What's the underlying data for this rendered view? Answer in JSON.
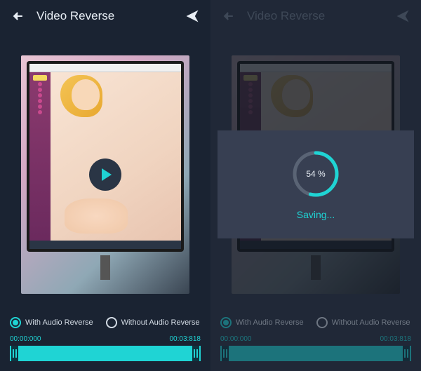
{
  "left": {
    "header": {
      "title": "Video Reverse"
    },
    "radios": {
      "with_audio": "With Audio Reverse",
      "without_audio": "Without Audio  Reverse"
    },
    "time": {
      "start": "00:00:000",
      "end": "00:03:818"
    }
  },
  "right": {
    "header": {
      "title": "Video Reverse"
    },
    "radios": {
      "with_audio": "With Audio Reverse",
      "without_audio": "Without Audio  Reverse"
    },
    "time": {
      "start": "00:00:000",
      "end": "00:03:818"
    },
    "save": {
      "percent_value": 54,
      "percent_label": "54 %",
      "status": "Saving..."
    }
  },
  "colors": {
    "accent": "#1fd4d4",
    "bg": "#1a2332"
  }
}
